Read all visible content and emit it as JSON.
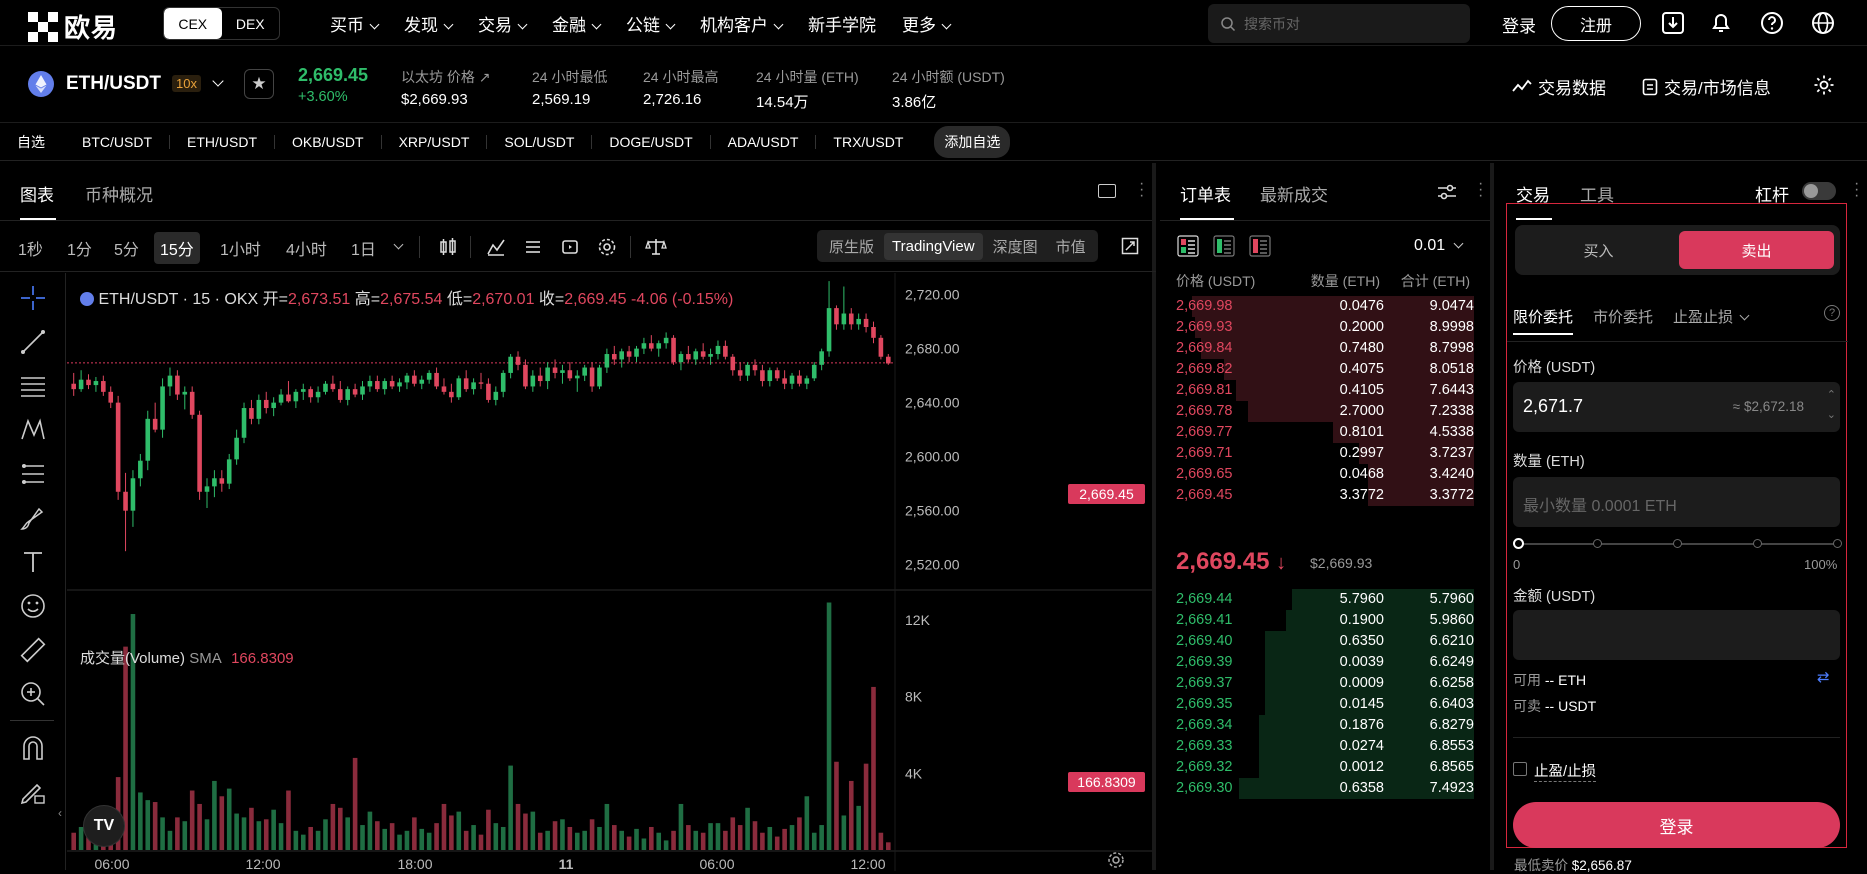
{
  "nav": {
    "logo_text": "欧易",
    "cex": "CEX",
    "dex": "DEX",
    "menu": [
      "买币",
      "发现",
      "交易",
      "金融",
      "公链",
      "机构客户",
      "新手学院",
      "更多"
    ],
    "search_placeholder": "搜索币对",
    "login": "登录",
    "register": "注册"
  },
  "ticker": {
    "pair": "ETH/USDT",
    "leverage": "10x",
    "price": "2,669.45",
    "change": "+3.60%",
    "stats": [
      {
        "label": "以太坊 价格",
        "value": "$2,669.93"
      },
      {
        "label": "24 小时最低",
        "value": "2,569.19"
      },
      {
        "label": "24 小时最高",
        "value": "2,726.16"
      },
      {
        "label": "24 小时量 (ETH)",
        "value": "14.54万"
      },
      {
        "label": "24 小时额 (USDT)",
        "value": "3.86亿"
      }
    ],
    "trade_data": "交易数据",
    "market_info": "交易/市场信息"
  },
  "favorites": {
    "label": "自选",
    "items": [
      "BTC/USDT",
      "ETH/USDT",
      "OKB/USDT",
      "XRP/USDT",
      "SOL/USDT",
      "DOGE/USDT",
      "ADA/USDT",
      "TRX/USDT"
    ],
    "add": "添加自选"
  },
  "chart_panel": {
    "tabs": [
      "图表",
      "币种概况"
    ],
    "timeframes": [
      "1秒",
      "1分",
      "5分",
      "15分",
      "1小时",
      "4小时",
      "1日"
    ],
    "active_timeframe": "15分",
    "views": [
      "原生版",
      "TradingView",
      "深度图",
      "市值"
    ],
    "active_view": "TradingView",
    "legend": {
      "symbol": "ETH/USDT · 15 · OKX",
      "open_label": "开=",
      "open": "2,673.51",
      "high_label": "高=",
      "high": "2,675.54",
      "low_label": "低=",
      "low": "2,670.01",
      "close_label": "收=",
      "close": "2,669.45",
      "change": "-4.06 (-0.15%)"
    },
    "volume_legend": {
      "label": "成交量(Volume)",
      "sma": "SMA",
      "value": "166.8309"
    },
    "price_tag": "2,669.45",
    "volume_tag": "166.8309"
  },
  "chart_data": {
    "type": "candlestick",
    "y_ticks": [
      "2,720.00",
      "2,680.00",
      "2,640.00",
      "2,600.00",
      "2,560.00",
      "2,520.00"
    ],
    "y_tick_values": [
      2720,
      2680,
      2640,
      2600,
      2560,
      2520
    ],
    "ylim": [
      2502,
      2736
    ],
    "x_ticks": [
      "06:00",
      "12:00",
      "18:00",
      "11",
      "06:00",
      "12:00"
    ],
    "volume_ticks": [
      "12K",
      "8K",
      "4K"
    ],
    "volume_tick_values": [
      12000,
      8000,
      4000
    ],
    "volume_max": 13500,
    "current_price": 2669.45,
    "candles": [
      [
        2654,
        2662,
        2645,
        2650
      ],
      [
        2650,
        2664,
        2648,
        2657
      ],
      [
        2657,
        2661,
        2650,
        2653
      ],
      [
        2653,
        2659,
        2648,
        2656
      ],
      [
        2656,
        2660,
        2645,
        2648
      ],
      [
        2648,
        2652,
        2636,
        2640
      ],
      [
        2640,
        2645,
        2568,
        2574
      ],
      [
        2574,
        2588,
        2530,
        2560
      ],
      [
        2560,
        2590,
        2548,
        2584
      ],
      [
        2584,
        2602,
        2578,
        2597
      ],
      [
        2597,
        2634,
        2590,
        2628
      ],
      [
        2628,
        2640,
        2618,
        2620
      ],
      [
        2620,
        2658,
        2614,
        2652
      ],
      [
        2652,
        2666,
        2645,
        2660
      ],
      [
        2660,
        2664,
        2642,
        2646
      ],
      [
        2646,
        2652,
        2635,
        2648
      ],
      [
        2648,
        2652,
        2628,
        2631
      ],
      [
        2631,
        2634,
        2568,
        2574
      ],
      [
        2574,
        2584,
        2562,
        2578
      ],
      [
        2578,
        2590,
        2570,
        2584
      ],
      [
        2584,
        2590,
        2574,
        2580
      ],
      [
        2580,
        2602,
        2576,
        2598
      ],
      [
        2598,
        2620,
        2594,
        2614
      ],
      [
        2614,
        2640,
        2610,
        2636
      ],
      [
        2636,
        2642,
        2624,
        2628
      ],
      [
        2628,
        2646,
        2624,
        2642
      ],
      [
        2642,
        2648,
        2632,
        2636
      ],
      [
        2636,
        2644,
        2630,
        2640
      ],
      [
        2640,
        2650,
        2638,
        2646
      ],
      [
        2646,
        2656,
        2640,
        2641
      ],
      [
        2641,
        2650,
        2636,
        2648
      ],
      [
        2648,
        2654,
        2642,
        2650
      ],
      [
        2650,
        2652,
        2640,
        2644
      ],
      [
        2644,
        2652,
        2640,
        2648
      ],
      [
        2648,
        2656,
        2646,
        2654
      ],
      [
        2654,
        2660,
        2648,
        2650
      ],
      [
        2650,
        2656,
        2640,
        2642
      ],
      [
        2642,
        2652,
        2638,
        2650
      ],
      [
        2650,
        2654,
        2644,
        2646
      ],
      [
        2646,
        2656,
        2642,
        2652
      ],
      [
        2652,
        2660,
        2648,
        2656
      ],
      [
        2656,
        2660,
        2648,
        2650
      ],
      [
        2650,
        2658,
        2646,
        2656
      ],
      [
        2656,
        2660,
        2650,
        2652
      ],
      [
        2652,
        2658,
        2648,
        2655
      ],
      [
        2655,
        2662,
        2650,
        2660
      ],
      [
        2660,
        2664,
        2652,
        2654
      ],
      [
        2654,
        2660,
        2650,
        2657
      ],
      [
        2657,
        2664,
        2654,
        2662
      ],
      [
        2662,
        2666,
        2650,
        2652
      ],
      [
        2652,
        2658,
        2646,
        2648
      ],
      [
        2648,
        2654,
        2640,
        2644
      ],
      [
        2644,
        2660,
        2642,
        2658
      ],
      [
        2658,
        2664,
        2648,
        2650
      ],
      [
        2650,
        2658,
        2646,
        2655
      ],
      [
        2655,
        2662,
        2650,
        2654
      ],
      [
        2654,
        2658,
        2640,
        2642
      ],
      [
        2642,
        2652,
        2638,
        2648
      ],
      [
        2648,
        2664,
        2644,
        2662
      ],
      [
        2662,
        2676,
        2658,
        2674
      ],
      [
        2674,
        2678,
        2664,
        2668
      ],
      [
        2668,
        2672,
        2650,
        2652
      ],
      [
        2652,
        2664,
        2648,
        2660
      ],
      [
        2660,
        2666,
        2652,
        2656
      ],
      [
        2656,
        2670,
        2650,
        2666
      ],
      [
        2666,
        2672,
        2658,
        2662
      ],
      [
        2662,
        2668,
        2654,
        2664
      ],
      [
        2664,
        2670,
        2656,
        2658
      ],
      [
        2658,
        2664,
        2648,
        2660
      ],
      [
        2660,
        2668,
        2656,
        2666
      ],
      [
        2666,
        2670,
        2648,
        2652
      ],
      [
        2652,
        2668,
        2650,
        2666
      ],
      [
        2666,
        2680,
        2662,
        2676
      ],
      [
        2676,
        2682,
        2668,
        2672
      ],
      [
        2672,
        2680,
        2666,
        2678
      ],
      [
        2678,
        2682,
        2670,
        2674
      ],
      [
        2674,
        2682,
        2670,
        2680
      ],
      [
        2680,
        2688,
        2676,
        2684
      ],
      [
        2684,
        2690,
        2678,
        2680
      ],
      [
        2680,
        2686,
        2674,
        2684
      ],
      [
        2684,
        2692,
        2680,
        2688
      ],
      [
        2688,
        2690,
        2668,
        2670
      ],
      [
        2670,
        2678,
        2664,
        2676
      ],
      [
        2676,
        2682,
        2670,
        2672
      ],
      [
        2672,
        2680,
        2668,
        2678
      ],
      [
        2678,
        2684,
        2672,
        2674
      ],
      [
        2674,
        2680,
        2668,
        2676
      ],
      [
        2676,
        2686,
        2672,
        2682
      ],
      [
        2682,
        2686,
        2672,
        2674
      ],
      [
        2674,
        2676,
        2660,
        2664
      ],
      [
        2664,
        2670,
        2656,
        2660
      ],
      [
        2660,
        2670,
        2656,
        2668
      ],
      [
        2668,
        2672,
        2660,
        2664
      ],
      [
        2664,
        2668,
        2652,
        2656
      ],
      [
        2656,
        2666,
        2652,
        2664
      ],
      [
        2664,
        2666,
        2656,
        2658
      ],
      [
        2658,
        2664,
        2650,
        2654
      ],
      [
        2654,
        2662,
        2650,
        2660
      ],
      [
        2660,
        2664,
        2652,
        2654
      ],
      [
        2654,
        2660,
        2650,
        2658
      ],
      [
        2658,
        2670,
        2656,
        2668
      ],
      [
        2668,
        2680,
        2664,
        2678
      ],
      [
        2678,
        2730,
        2674,
        2710
      ],
      [
        2710,
        2712,
        2694,
        2698
      ],
      [
        2698,
        2726,
        2694,
        2706
      ],
      [
        2706,
        2710,
        2694,
        2698
      ],
      [
        2698,
        2706,
        2694,
        2702
      ],
      [
        2702,
        2706,
        2692,
        2696
      ],
      [
        2696,
        2700,
        2684,
        2688
      ],
      [
        2688,
        2690,
        2672,
        2674
      ],
      [
        2674,
        2676,
        2668,
        2669
      ]
    ],
    "volumes": [
      900,
      1200,
      1600,
      900,
      1400,
      1500,
      3800,
      10600,
      12300,
      3000,
      2600,
      2500,
      1700,
      1000,
      1700,
      1500,
      3100,
      2400,
      1600,
      3600,
      2800,
      3200,
      1900,
      1700,
      2200,
      1500,
      1600,
      2100,
      1400,
      3100,
      1000,
      800,
      1200,
      1000,
      1600,
      2400,
      2200,
      1700,
      4800,
      1300,
      2000,
      1500,
      1100,
      1400,
      800,
      1000,
      1700,
      1100,
      900,
      1400,
      2400,
      1800,
      2000,
      1000,
      1300,
      800,
      2100,
      1400,
      1200,
      4400,
      2400,
      1900,
      2000,
      900,
      1000,
      1500,
      1600,
      1200,
      900,
      1000,
      1600,
      1200,
      2400,
      1300,
      1000,
      700,
      1100,
      600,
      1200,
      900,
      500,
      1000,
      2400,
      1300,
      1000,
      900,
      1400,
      1400,
      1000,
      1700,
      1300,
      2200,
      1500,
      900,
      1200,
      700,
      1100,
      1300,
      1700,
      2800,
      900,
      1300,
      12900,
      4600,
      1800,
      3600,
      2300,
      4500,
      8500,
      900,
      400
    ]
  },
  "orderbook": {
    "tabs": [
      "订单表",
      "最新成交"
    ],
    "precision": "0.01",
    "headers": [
      "价格 (USDT)",
      "数量 (ETH)",
      "合计 (ETH)"
    ],
    "asks": [
      [
        "2,669.98",
        "0.0476",
        "9.0474"
      ],
      [
        "2,669.93",
        "0.2000",
        "8.9998"
      ],
      [
        "2,669.84",
        "0.7480",
        "8.7998"
      ],
      [
        "2,669.82",
        "0.4075",
        "8.0518"
      ],
      [
        "2,669.81",
        "0.4105",
        "7.6443"
      ],
      [
        "2,669.78",
        "2.7000",
        "7.2338"
      ],
      [
        "2,669.77",
        "0.8101",
        "4.5338"
      ],
      [
        "2,669.71",
        "0.2997",
        "3.7237"
      ],
      [
        "2,669.65",
        "0.0468",
        "3.4240"
      ],
      [
        "2,669.45",
        "3.3772",
        "3.3772"
      ]
    ],
    "last_price": "2,669.45",
    "last_usd": "$2,669.93",
    "bids": [
      [
        "2,669.44",
        "5.7960",
        "5.7960"
      ],
      [
        "2,669.41",
        "0.1900",
        "5.9860"
      ],
      [
        "2,669.40",
        "0.6350",
        "6.6210"
      ],
      [
        "2,669.39",
        "0.0039",
        "6.6249"
      ],
      [
        "2,669.37",
        "0.0009",
        "6.6258"
      ],
      [
        "2,669.35",
        "0.0145",
        "6.6403"
      ],
      [
        "2,669.34",
        "0.1876",
        "6.8279"
      ],
      [
        "2,669.33",
        "0.0274",
        "6.8553"
      ],
      [
        "2,669.32",
        "0.0012",
        "6.8565"
      ],
      [
        "2,669.30",
        "0.6358",
        "7.4923"
      ]
    ],
    "ask_depth": [
      0.96,
      0.95,
      0.93,
      0.85,
      0.81,
      0.77,
      0.48,
      0.39,
      0.36,
      0.36
    ],
    "bid_depth": [
      0.62,
      0.64,
      0.71,
      0.71,
      0.71,
      0.71,
      0.73,
      0.73,
      0.73,
      0.8
    ]
  },
  "trade": {
    "tabs": [
      "交易",
      "工具"
    ],
    "margin_label": "杠杆",
    "buy": "买入",
    "sell": "卖出",
    "order_types": [
      "限价委托",
      "市价委托",
      "止盈止损"
    ],
    "price_label": "价格 (USDT)",
    "price_value": "2,671.7",
    "price_usd": "≈ $2,672.18",
    "qty_label": "数量 (ETH)",
    "qty_placeholder": "最小数量 0.0001 ETH",
    "slider_min": "0",
    "slider_max": "100%",
    "amount_label": "金额 (USDT)",
    "available_label": "可用",
    "available_value": "-- ETH",
    "sellable_label": "可卖",
    "sellable_value": "-- USDT",
    "tpsl": "止盈/止损",
    "login_button": "登录",
    "min_sell_label": "最低卖价",
    "min_sell_value": "$2,656.87"
  },
  "colors": {
    "up": "#2fbd6a",
    "down": "#e0475f",
    "accent": "#d9395c",
    "highlight": "#d7263d"
  }
}
